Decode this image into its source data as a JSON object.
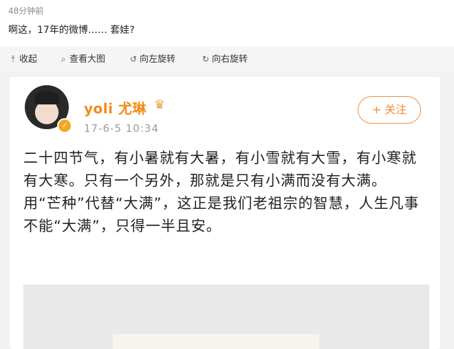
{
  "header": {
    "time": "48分钟前",
    "text": "啊这，17年的微博…… 套娃?"
  },
  "toolbar": {
    "items": [
      {
        "label": "收起",
        "icon": "collapse-icon"
      },
      {
        "label": "查看大图",
        "icon": "search-icon"
      },
      {
        "label": "向左旋转",
        "icon": "rotate-left-icon"
      },
      {
        "label": "向右旋转",
        "icon": "rotate-right-icon"
      }
    ]
  },
  "weibo": {
    "username": "yoli 尤琳",
    "date": "17-6-5 10:34",
    "follow_label": "+ 关注",
    "paragraph1": "二十四节气，有小暑就有大暑，有小雪就有大雪，有小寒就有大寒。只有一个另外，那就是只有小满而没有大满。",
    "paragraph2": "用“芒种”代替“大满”，这正是我们老祖宗的智慧，人生凡事不能“大满”，只得一半且安。"
  },
  "colors": {
    "accent": "#f48a18",
    "follow": "#f08c3c",
    "verified": "#f5a623"
  }
}
